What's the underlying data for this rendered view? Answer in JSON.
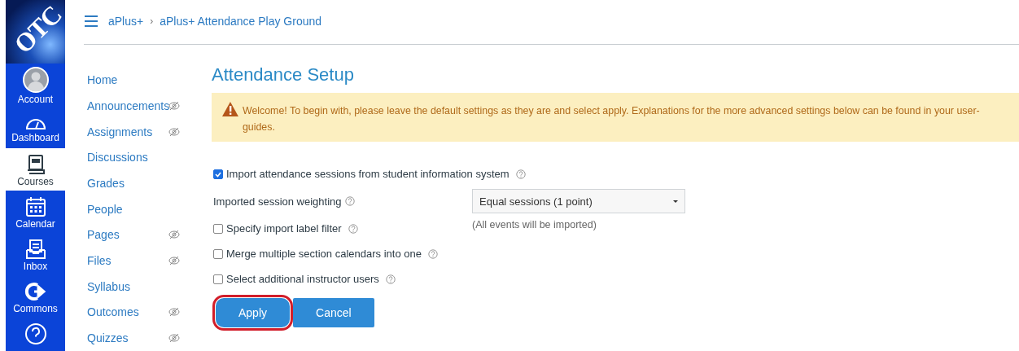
{
  "logo": {
    "text": "OTC"
  },
  "global_nav": [
    {
      "label": "Account",
      "kind": "account",
      "selected": false
    },
    {
      "label": "Dashboard",
      "kind": "dashboard",
      "selected": false
    },
    {
      "label": "Courses",
      "kind": "courses",
      "selected": true
    },
    {
      "label": "Calendar",
      "kind": "calendar",
      "selected": false
    },
    {
      "label": "Inbox",
      "kind": "inbox",
      "selected": false
    },
    {
      "label": "Commons",
      "kind": "commons",
      "selected": false
    },
    {
      "kind": "help",
      "selected": false
    }
  ],
  "breadcrumb": {
    "separator": "›",
    "items": [
      "aPlus+",
      "aPlus+ Attendance Play Ground"
    ]
  },
  "course_nav": [
    {
      "label": "Home",
      "hidden": false
    },
    {
      "label": "Announcements",
      "hidden": true
    },
    {
      "label": "Assignments",
      "hidden": true
    },
    {
      "label": "Discussions",
      "hidden": false
    },
    {
      "label": "Grades",
      "hidden": false
    },
    {
      "label": "People",
      "hidden": false
    },
    {
      "label": "Pages",
      "hidden": true
    },
    {
      "label": "Files",
      "hidden": true
    },
    {
      "label": "Syllabus",
      "hidden": false
    },
    {
      "label": "Outcomes",
      "hidden": true
    },
    {
      "label": "Quizzes",
      "hidden": true
    }
  ],
  "page_title": "Attendance Setup",
  "alert": "Welcome! To begin with, please leave the default settings as they are and select apply. Explanations for the more advanced settings below can be found in your user-guides.",
  "settings": [
    {
      "kind": "checkbox",
      "label": "Import attendance sessions from student information system",
      "checked": true
    },
    {
      "kind": "select",
      "label": "Imported session weighting",
      "value": "Equal sessions (1 point)"
    },
    {
      "kind": "checkbox",
      "label": "Specify import label filter",
      "checked": false,
      "note": "(All events will be imported)"
    },
    {
      "kind": "checkbox",
      "label": "Merge multiple section calendars into one",
      "checked": false
    },
    {
      "kind": "checkbox",
      "label": "Select additional instructor users",
      "checked": false
    }
  ],
  "buttons": [
    {
      "label": "Apply",
      "highlighted": true
    },
    {
      "label": "Cancel",
      "highlighted": false
    }
  ]
}
